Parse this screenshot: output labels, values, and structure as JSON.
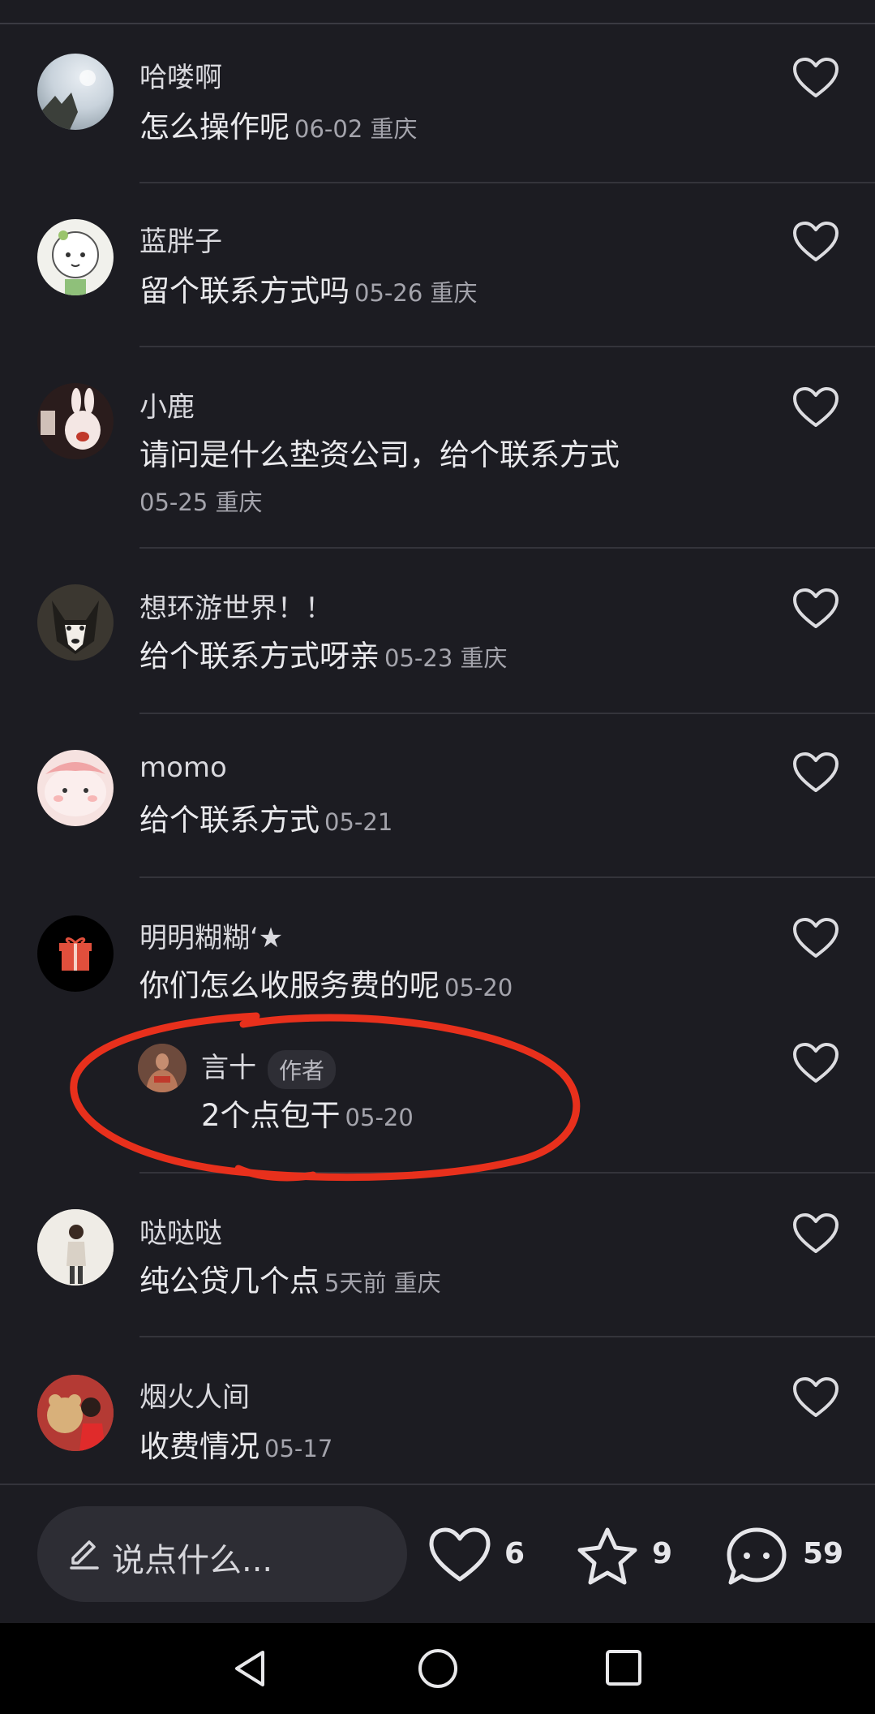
{
  "comments": [
    {
      "name": "哈喽啊",
      "text": "怎么操作呢",
      "meta": "06-02 重庆"
    },
    {
      "name": "蓝胖子",
      "text": "留个联系方式吗",
      "meta": "05-26 重庆"
    },
    {
      "name": "小鹿",
      "text": "请问是什么垫资公司，给个联系方式",
      "meta": "05-25 重庆"
    },
    {
      "name": "想环游世界！！",
      "text": "给个联系方式呀亲",
      "meta": "05-23 重庆"
    },
    {
      "name": "momo",
      "text": "给个联系方式",
      "meta": "05-21"
    },
    {
      "name": "明明糊糊‘★",
      "text": "你们怎么收服务费的呢",
      "meta": "05-20"
    },
    {
      "name": "哒哒哒",
      "text": "纯公贷几个点",
      "meta": "5天前  重庆"
    },
    {
      "name": "烟火人间",
      "text": "收费情况",
      "meta": "05-17"
    }
  ],
  "reply": {
    "name": "言十",
    "badge": "作者",
    "text": "2个点包干",
    "meta": "05-20"
  },
  "bottom_bar": {
    "input_placeholder": "说点什么...",
    "likes": "6",
    "favorites": "9",
    "comments": "59"
  },
  "colors": {
    "background": "#1c1c22",
    "annotation": "#e8301c",
    "navbar": "#000000"
  },
  "icons": [
    "heart-icon",
    "pen-icon",
    "star-icon",
    "comment-bubble-icon",
    "gift-icon",
    "nav-back-icon",
    "nav-home-icon",
    "nav-recents-icon"
  ]
}
